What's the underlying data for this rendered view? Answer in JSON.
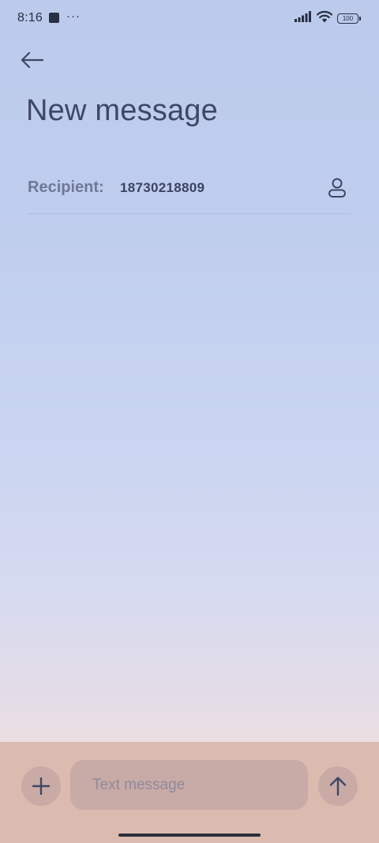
{
  "status_bar": {
    "time": "8:16",
    "dots": "···",
    "battery": "100",
    "icons": [
      "notification-square-icon",
      "signal-icon",
      "wifi-icon",
      "battery-icon"
    ]
  },
  "header": {
    "back_icon": "back-arrow-icon",
    "title": "New message"
  },
  "recipient": {
    "label": "Recipient:",
    "value": "18730218809",
    "contact_icon": "contact-person-icon"
  },
  "compose": {
    "add_icon": "plus-icon",
    "placeholder": "Text message",
    "value": "",
    "send_icon": "arrow-up-icon"
  },
  "colors": {
    "text_primary": "#3f4766",
    "label": "#6f7896",
    "compose_bar": "#dbbbb0",
    "compose_control": "#c9aaa5"
  }
}
